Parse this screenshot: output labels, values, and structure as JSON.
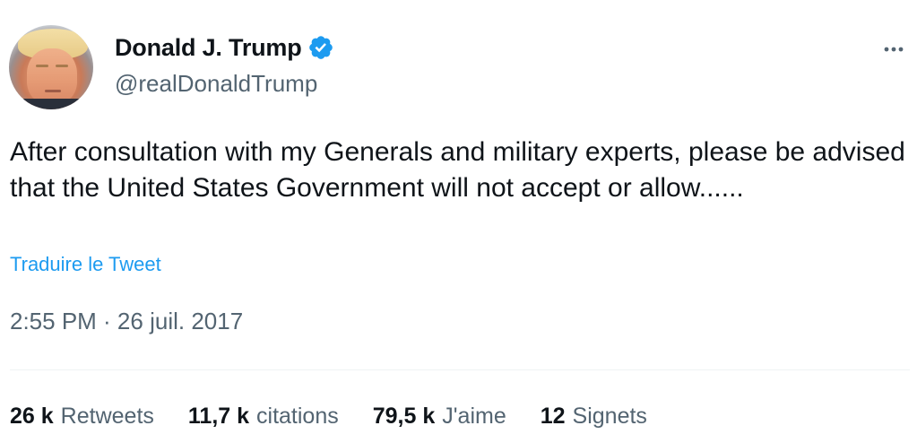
{
  "author": {
    "display_name": "Donald J. Trump",
    "handle": "@realDonaldTrump",
    "verified_icon": "verified-badge-icon",
    "verified_color": "#1d9bf0"
  },
  "tweet": {
    "text": "After consultation with my Generals and military experts, please be advised that the United States Government will not accept or allow......",
    "translate_label": "Traduire le Tweet",
    "timestamp": "2:55 PM · 26 juil. 2017"
  },
  "stats": [
    {
      "count": "26 k",
      "label": "Retweets"
    },
    {
      "count": "11,7 k",
      "label": "citations"
    },
    {
      "count": "79,5 k",
      "label": "J'aime"
    },
    {
      "count": "12",
      "label": "Signets"
    }
  ],
  "colors": {
    "text": "#0f1419",
    "secondary": "#536471",
    "link": "#1d9bf0",
    "divider": "#eff3f4"
  },
  "icons": {
    "more": "more-horizontal-icon"
  }
}
